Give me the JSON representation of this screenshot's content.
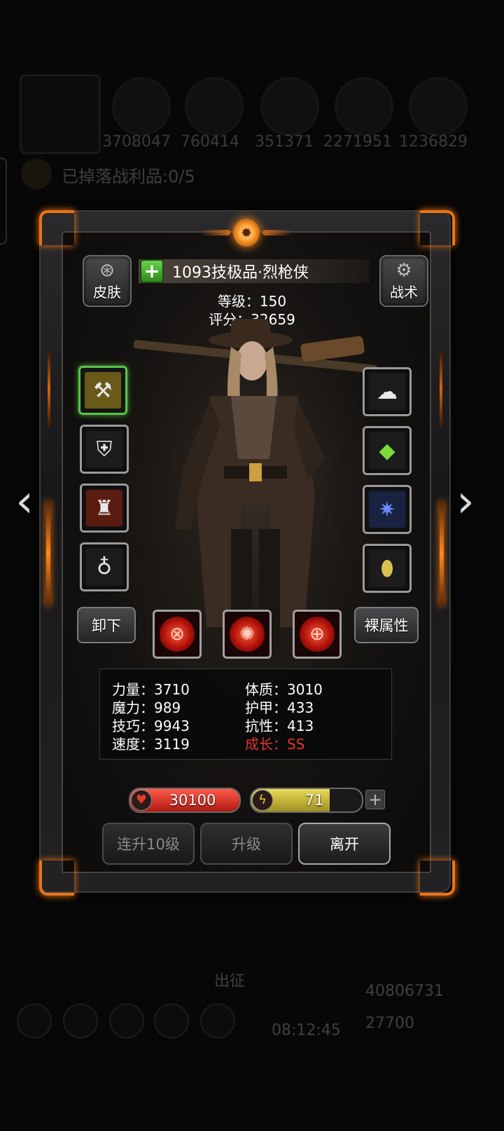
{
  "background": {
    "resources": [
      "3708047",
      "760414",
      "351371",
      "2271951",
      "1236829"
    ],
    "loot_status": "已掉落战利品:0/5",
    "bottom_label": "出征",
    "bottom_gold": "40806731",
    "bottom_gems": "27700",
    "timer": "08:12:45"
  },
  "header": {
    "skin_label": "皮肤",
    "tactic_label": "战术",
    "hero_name": "1093技极品·烈枪侠",
    "level_text": "等级：150",
    "score_text": "评分：32659"
  },
  "equipment": {
    "left": [
      {
        "name": "weapon",
        "icon": "golden-gun"
      },
      {
        "name": "armor",
        "icon": "chest-armor"
      },
      {
        "name": "accessory",
        "icon": "bronze-totem"
      },
      {
        "name": "amulet",
        "icon": "amulet"
      }
    ],
    "right": [
      {
        "name": "wing",
        "icon": "cloud-wing"
      },
      {
        "name": "gem",
        "icon": "green-crystal"
      },
      {
        "name": "emblem",
        "icon": "blue-spider"
      },
      {
        "name": "relic",
        "icon": "golden-egg"
      }
    ]
  },
  "actions": {
    "unequip_label": "卸下",
    "bare_stats_label": "裸属性"
  },
  "skills": [
    {
      "name": "crosshair-skill",
      "icon": "target"
    },
    {
      "name": "vortex-skill",
      "icon": "swirl"
    },
    {
      "name": "scope-skill",
      "icon": "scope"
    }
  ],
  "stats": {
    "strength": "力量：3710",
    "constitution": "体质：3010",
    "magic": "魔力：989",
    "armor": "护甲：433",
    "skill": "技巧：9943",
    "resistance": "抗性：413",
    "speed": "速度：3119",
    "growth": "成长：SS"
  },
  "bars": {
    "hp_value": "30100",
    "hp_fraction": 1.0,
    "energy_value": "71",
    "energy_fraction": 0.71
  },
  "buttons": {
    "level_up_10": "连升10级",
    "level_up": "升级",
    "leave": "离开"
  },
  "colors": {
    "accent_orange": "#ff8a1e",
    "growth_red": "#e2352a",
    "hp_red": "#c0201a",
    "energy_yellow": "#d8c84a"
  }
}
